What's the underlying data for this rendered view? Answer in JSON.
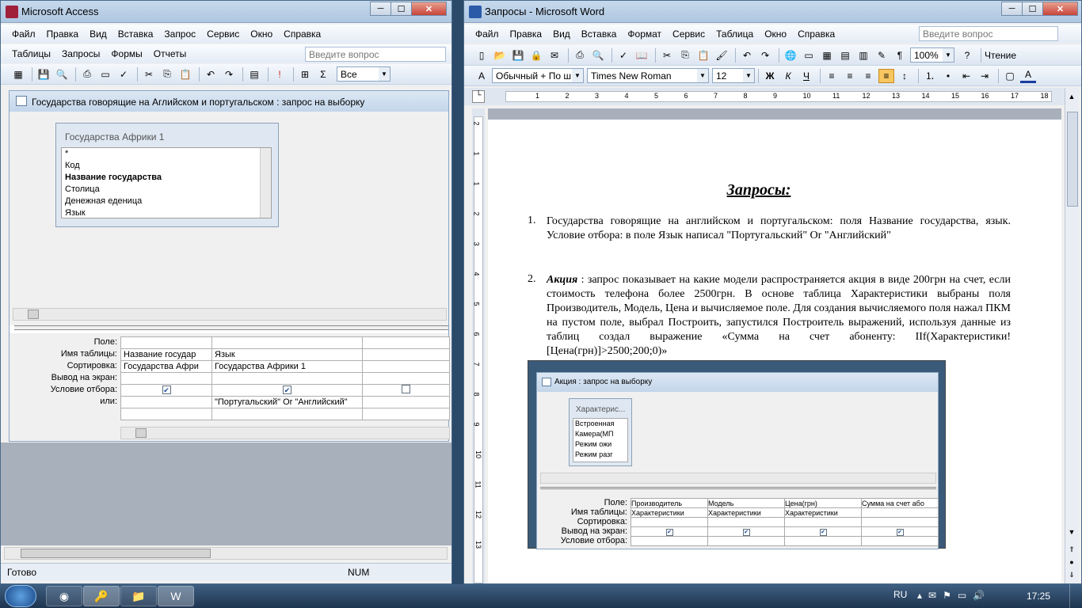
{
  "access": {
    "title": "Microsoft Access",
    "menu": [
      "Файл",
      "Правка",
      "Вид",
      "Вставка",
      "Запрос",
      "Сервис",
      "Окно",
      "Справка"
    ],
    "menu2": [
      "Таблицы",
      "Запросы",
      "Формы",
      "Отчеты"
    ],
    "ask_placeholder": "Введите вопрос",
    "topvalues": "Все",
    "query_title": "Государства говорящие на Аглийском и португальском : запрос на выборку",
    "table_name": "Государства Африки 1",
    "fields": [
      "*",
      "Код",
      "Название государства",
      "Столица",
      "Денежная еденица",
      "Язык"
    ],
    "row_labels": [
      "Поле:",
      "Имя таблицы:",
      "Сортировка:",
      "Вывод на экран:",
      "Условие отбора:",
      "или:"
    ],
    "col1": {
      "field": "Название государ",
      "table": "Государства Афри"
    },
    "col2": {
      "field": "Язык",
      "table": "Государства Африки 1",
      "criteria": "\"Португальский\" Or \"Английский\""
    },
    "status": "Готово",
    "num": "NUM"
  },
  "word": {
    "title": "Запросы - Microsoft Word",
    "menu": [
      "Файл",
      "Правка",
      "Вид",
      "Вставка",
      "Формат",
      "Сервис",
      "Таблица",
      "Окно",
      "Справка"
    ],
    "ask_placeholder": "Введите вопрос",
    "zoom": "100%",
    "reading": "Чтение",
    "style": "Обычный + По ш",
    "font": "Times New Roman",
    "size": "12",
    "ruler": [
      "1",
      "2",
      "3",
      "4",
      "5",
      "6",
      "7",
      "8",
      "9",
      "10",
      "11",
      "12",
      "13",
      "14",
      "15",
      "16",
      "17",
      "18"
    ],
    "vruler": [
      "2",
      "1",
      "1",
      "2",
      "3",
      "4",
      "5",
      "6",
      "7",
      "8",
      "9",
      "10",
      "11",
      "12",
      "13"
    ],
    "heading": "Запросы:",
    "item1_num": "1.",
    "item1": "Государства говорящие на английском и португальском: поля Название государства, язык. Условие отбора: в поле Язык написал \"Португальский\" Or \"Английский\"",
    "item2_num": "2.",
    "item2_bold": "Акция",
    "item2": " : запрос показывает на какие модели распространяется акция в виде 200грн на счет, если стоимость телефона более 2500грн. В основе таблица Характеристики выбраны поля Производитель, Модель, Цена и вычисляемое поле. Для создания вычисляемого поля нажал ПКМ на пустом поле, выбрал Построить, запустился Построитель выражений, используя данные из таблиц создал выражение «Сумма на счет абоненту: IIf(Характеристики![Цена(грн)]>2500;200;0)»",
    "embed": {
      "title": "Акция : запрос на выборку",
      "table": "Характерис...",
      "fields": [
        "Встроенная",
        "Камера(МП",
        "Режим ожи",
        "Режим разг"
      ],
      "row_labels": [
        "Поле:",
        "Имя таблицы:",
        "Сортировка:",
        "Вывод на экран:",
        "Условие отбора:"
      ],
      "cols": [
        {
          "field": "Производитель",
          "table": "Характеристики"
        },
        {
          "field": "Модель",
          "table": "Характеристики"
        },
        {
          "field": "Цена(грн)",
          "table": "Характеристики"
        },
        {
          "field": "Сумма на счет або",
          "table": ""
        }
      ]
    }
  },
  "taskbar": {
    "lang": "RU",
    "time": "17:25"
  }
}
